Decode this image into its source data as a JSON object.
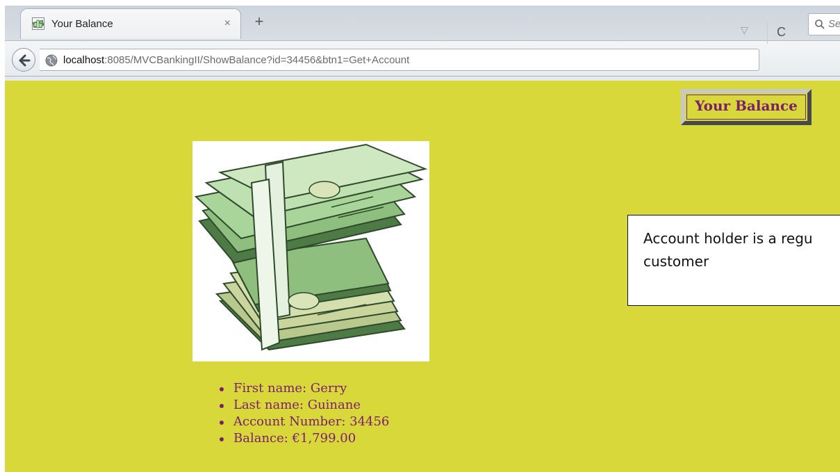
{
  "browser": {
    "tab": {
      "title": "Your Balance",
      "close_glyph": "×",
      "favicon": "money-favicon-icon"
    },
    "new_tab_glyph": "+",
    "url": {
      "host": "localhost",
      "rest": ":8085/MVCBankingII/ShowBalance?id=34456&btn1=Get+Account"
    },
    "dropmarker_glyph": "▽",
    "reload_glyph": "C",
    "search": {
      "placeholder": "Se"
    }
  },
  "page": {
    "background": "#d8d83a",
    "accent_text": "#7b1e6e",
    "header_button": "Your Balance",
    "image": "money-stack-icon",
    "info_box": {
      "line1": "Account holder is a regu",
      "line2": "customer"
    },
    "details": [
      "First name: Gerry",
      "Last name: Guinane",
      "Account Number: 34456",
      "Balance: €1,799.00"
    ]
  }
}
